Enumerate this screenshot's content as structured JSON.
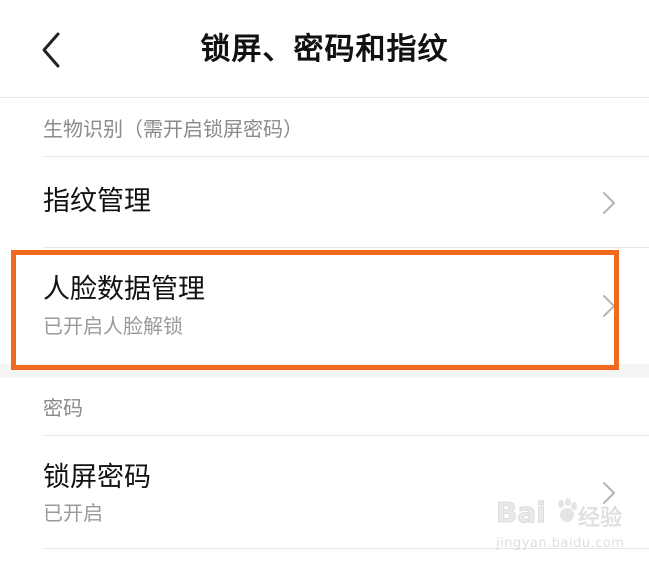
{
  "header": {
    "title": "锁屏、密码和指纹",
    "back_icon": "chevron-left-icon"
  },
  "sections": {
    "biometrics": {
      "label": "生物识别（需开启锁屏密码）",
      "items": [
        {
          "title": "指纹管理",
          "subtitle": ""
        },
        {
          "title": "人脸数据管理",
          "subtitle": "已开启人脸解锁"
        }
      ]
    },
    "password": {
      "label": "密码",
      "items": [
        {
          "title": "锁屏密码",
          "subtitle": "已开启"
        }
      ]
    }
  },
  "highlight": {
    "color": "#f26a1f"
  },
  "watermark": {
    "brand": "Bai",
    "brand2": "经验",
    "url": "jingyan.baidu.com"
  },
  "colors": {
    "background": "#ffffff",
    "section_gap": "#f5f5f5",
    "divider": "#e6e6e6",
    "secondary_text": "#9a9a9a",
    "accent_highlight": "#f26a1f"
  }
}
